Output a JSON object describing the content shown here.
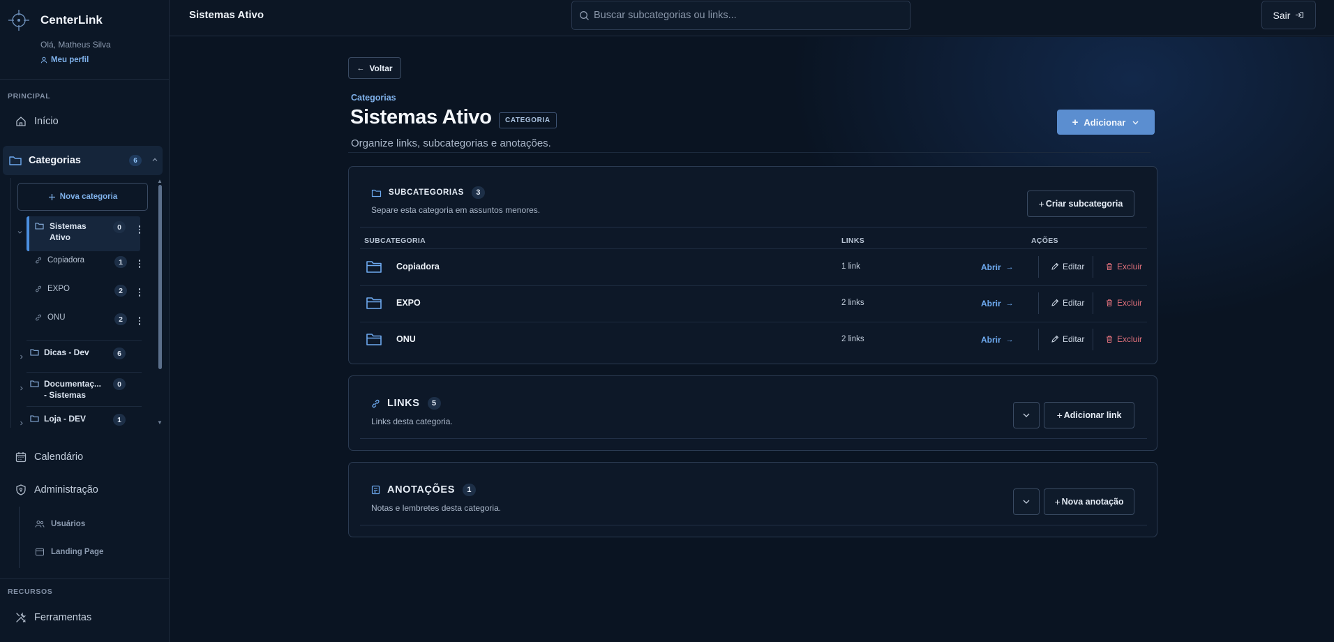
{
  "app": {
    "name": "CenterLink",
    "greeting": "Olá, Matheus Silva",
    "profile_label": "Meu perfil"
  },
  "sidebar": {
    "section_principal": "PRINCIPAL",
    "home": "Início",
    "categories_label": "Categorias",
    "categories_count": "6",
    "new_category": "Nova categoria",
    "tree": [
      {
        "label": "Sistemas Ativo",
        "count": "0",
        "children": [
          {
            "label": "Copiadora",
            "count": "1"
          },
          {
            "label": "EXPO",
            "count": "2"
          },
          {
            "label": "ONU",
            "count": "2"
          }
        ]
      },
      {
        "label": "Dicas - Dev",
        "count": "6"
      },
      {
        "label": "Documentaç... - Sistemas",
        "count": "0"
      },
      {
        "label": "Loja - DEV",
        "count": "1"
      }
    ],
    "calendar": "Calendário",
    "admin": "Administração",
    "admin_users": "Usuários",
    "admin_landing": "Landing Page",
    "section_recursos": "RECURSOS",
    "tools": "Ferramentas"
  },
  "topbar": {
    "page_title": "Sistemas Ativo",
    "search_placeholder": "Buscar subcategorias ou links...",
    "logout": "Sair"
  },
  "main": {
    "back": "Voltar",
    "breadcrumb": "Categorias",
    "title": "Sistemas Ativo",
    "badge": "CATEGORIA",
    "subtitle": "Organize links, subcategorias e anotações.",
    "add_button": "Adicionar"
  },
  "subcategories": {
    "title": "SUBCATEGORIAS",
    "count": "3",
    "description": "Separe esta categoria em assuntos menores.",
    "create_button": "Criar subcategoria",
    "columns": [
      "SUBCATEGORIA",
      "LINKS",
      "AÇÕES"
    ],
    "rows": [
      {
        "name": "Copiadora",
        "links": "1 link"
      },
      {
        "name": "EXPO",
        "links": "2 links"
      },
      {
        "name": "ONU",
        "links": "2 links"
      }
    ],
    "open_label": "Abrir",
    "edit_label": "Editar",
    "delete_label": "Excluir"
  },
  "links_section": {
    "title": "LINKS",
    "count": "5",
    "description": "Links desta categoria.",
    "add_button": "Adicionar link"
  },
  "notes_section": {
    "title": "ANOTAÇÕES",
    "count": "1",
    "description": "Notas e lembretes desta categoria.",
    "add_button": "Nova anotação"
  },
  "colors": {
    "accent": "#5b8ed0",
    "link": "#6eaaf0",
    "danger": "#e0707b",
    "background": "#0b1524"
  }
}
